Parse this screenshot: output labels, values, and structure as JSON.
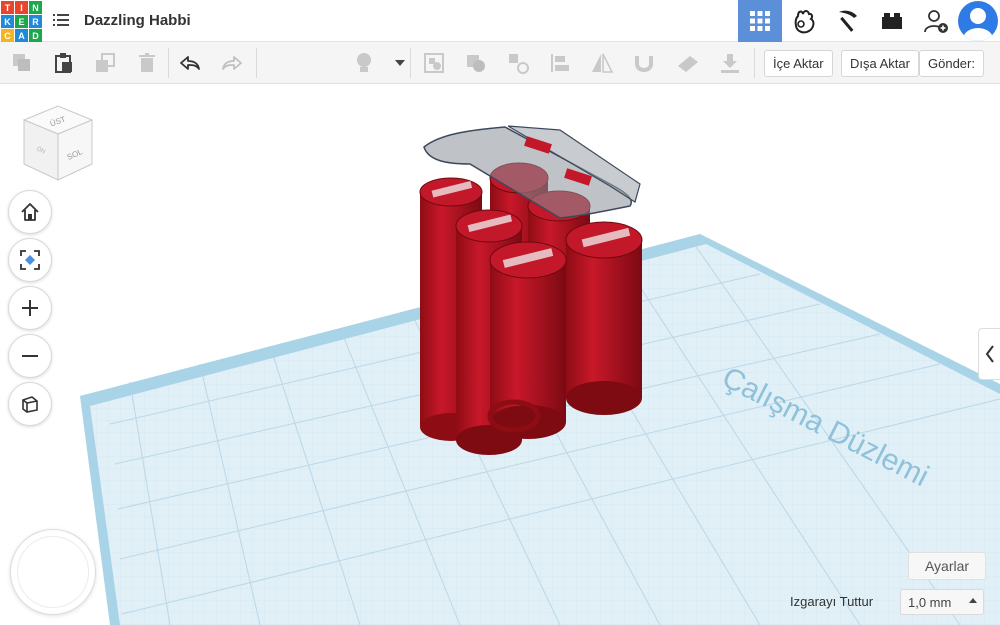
{
  "logo": {
    "letters": [
      "T",
      "I",
      "N",
      "K",
      "E",
      "R",
      "C",
      "A",
      "D"
    ],
    "colors": [
      "#e8452c",
      "#e8452c",
      "#1aa84a",
      "#1f8ad8",
      "#1aa84a",
      "#1f8ad8",
      "#f3b322",
      "#1f8ad8",
      "#1aa84a"
    ]
  },
  "header": {
    "title": "Dazzling Habbi",
    "icons": [
      "grid-view-icon",
      "tinkercad-team-icon",
      "pickaxe-icon",
      "brick-icon",
      "add-user-icon"
    ]
  },
  "toolbar": {
    "import_label": "İçe Aktar",
    "export_label": "Dışa Aktar",
    "send_label": "Gönder:"
  },
  "viewcube": {
    "front_label": "SOL",
    "top_label": "ÜST",
    "side_label": "ÖN"
  },
  "workplane": {
    "label": "Çalışma Düzlemi"
  },
  "settings": {
    "label": "Ayarlar"
  },
  "snap": {
    "label": "Izgarayı Tuttur",
    "value": "1,0 mm"
  },
  "colors": {
    "accent": "#5b8fd8",
    "shape_red": "#b8121f",
    "workplane": "#dfeef6",
    "grid_line": "#b8d7e6"
  }
}
